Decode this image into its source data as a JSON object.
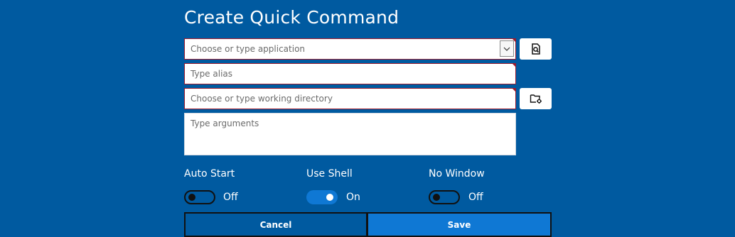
{
  "title": "Create Quick Command",
  "fields": {
    "application": {
      "placeholder": "Choose or type application",
      "value": ""
    },
    "alias": {
      "placeholder": "Type alias",
      "value": ""
    },
    "working_directory": {
      "placeholder": "Choose or type working directory",
      "value": ""
    },
    "arguments": {
      "placeholder": "Type arguments",
      "value": ""
    }
  },
  "toggles": {
    "auto_start": {
      "label": "Auto Start",
      "state": "Off",
      "on": false
    },
    "use_shell": {
      "label": "Use Shell",
      "state": "On",
      "on": true
    },
    "no_window": {
      "label": "No Window",
      "state": "Off",
      "on": false
    }
  },
  "buttons": {
    "cancel": "Cancel",
    "save": "Save"
  },
  "icons": {
    "browse_application": "file-search-icon",
    "browse_directory": "folder-settings-icon",
    "dropdown": "chevron-down-icon"
  },
  "colors": {
    "background": "#005aa0",
    "accent": "#0f78d4",
    "error_border": "#9c1c2e"
  }
}
